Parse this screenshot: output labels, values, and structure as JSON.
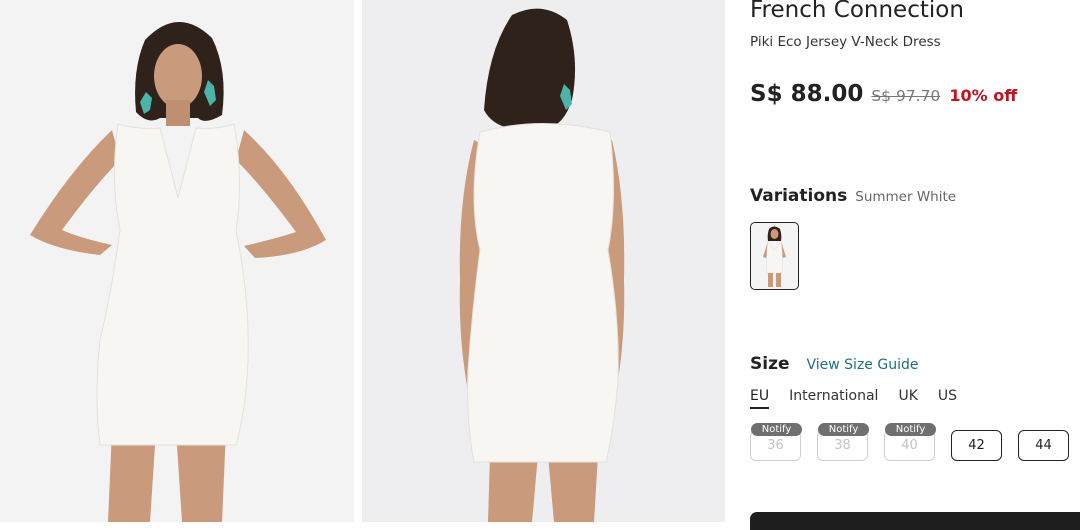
{
  "product": {
    "brand": "French Connection",
    "name": "Piki Eco Jersey V-Neck Dress"
  },
  "price": {
    "current": "S$ 88.00",
    "original": "S$ 97.70",
    "discount": "10% off"
  },
  "variations": {
    "heading": "Variations",
    "selected": "Summer White"
  },
  "size": {
    "heading": "Size",
    "guide_link": "View Size Guide",
    "systems": [
      "EU",
      "International",
      "UK",
      "US"
    ],
    "active_system": "EU",
    "options": [
      {
        "label": "36",
        "available": false,
        "badge": "Notify"
      },
      {
        "label": "38",
        "available": false,
        "badge": "Notify"
      },
      {
        "label": "40",
        "available": false,
        "badge": "Notify"
      },
      {
        "label": "42",
        "available": true
      },
      {
        "label": "44",
        "available": true
      }
    ]
  },
  "colors": {
    "discount": "#c1121f",
    "link": "#1f6f7d",
    "dress": "#f7f6f2",
    "hair": "#2f221b",
    "earring": "#4bb3a8"
  }
}
